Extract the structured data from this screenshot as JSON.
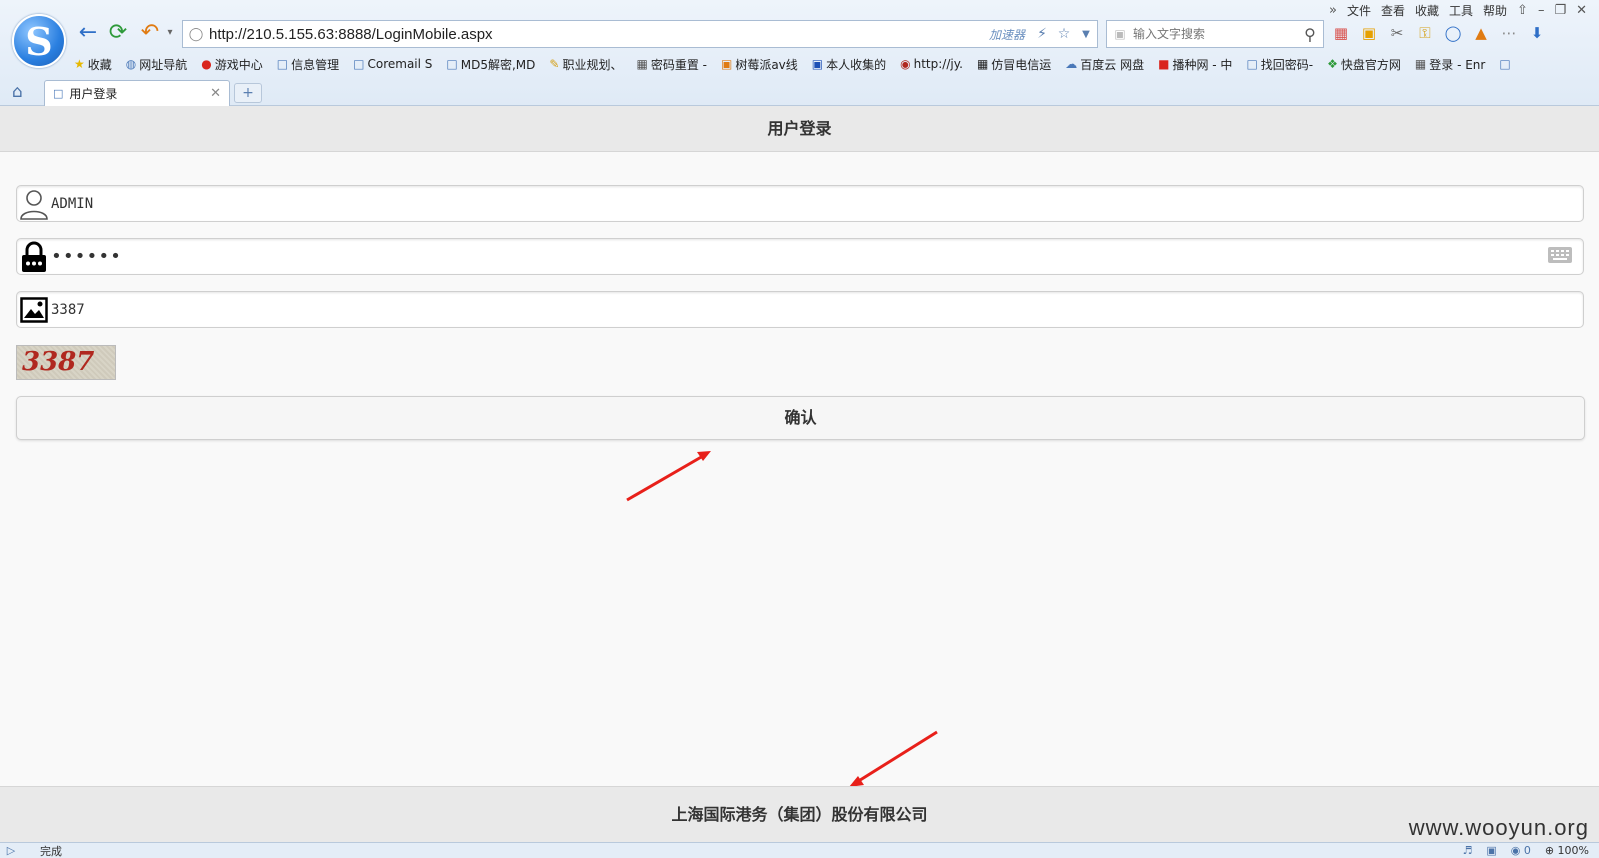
{
  "browser": {
    "menu": [
      "文件",
      "查看",
      "收藏",
      "工具",
      "帮助"
    ],
    "address_url": "http://210.5.155.63:8888/LoginMobile.aspx",
    "accelerator_label": "加速器",
    "search_placeholder": "输入文字搜索",
    "bookmarks": [
      "收藏",
      "网址导航",
      "游戏中心",
      "信息管理",
      "Coremail S",
      "MD5解密,MD",
      "职业规划、",
      "密码重置 -",
      "树莓派av线",
      "本人收集的",
      "http://jy.",
      "仿冒电信运",
      "百度云 网盘",
      "播种网 - 中",
      "找回密码-",
      "快盘官方网",
      "登录 - Enr"
    ],
    "tab_title": "用户登录",
    "new_tab": "+",
    "status_text": "完成",
    "status_count": "0",
    "zoom": "100%"
  },
  "page": {
    "header_title": "用户登录",
    "username_value": "ADMIN",
    "password_value": "••••••",
    "captcha_input_value": "3387",
    "captcha_image_text": "3387",
    "submit_label": "确认",
    "footer_text": "上海国际港务（集团）股份有限公司"
  },
  "watermark": "www.wooyun.org",
  "colors": {
    "annotation_arrow": "#e8201a",
    "captcha_text": "#b0281f",
    "browser_accent": "#2a7fe0"
  },
  "icons": [
    "user-icon",
    "lock-icon",
    "image-icon",
    "keyboard-icon"
  ]
}
